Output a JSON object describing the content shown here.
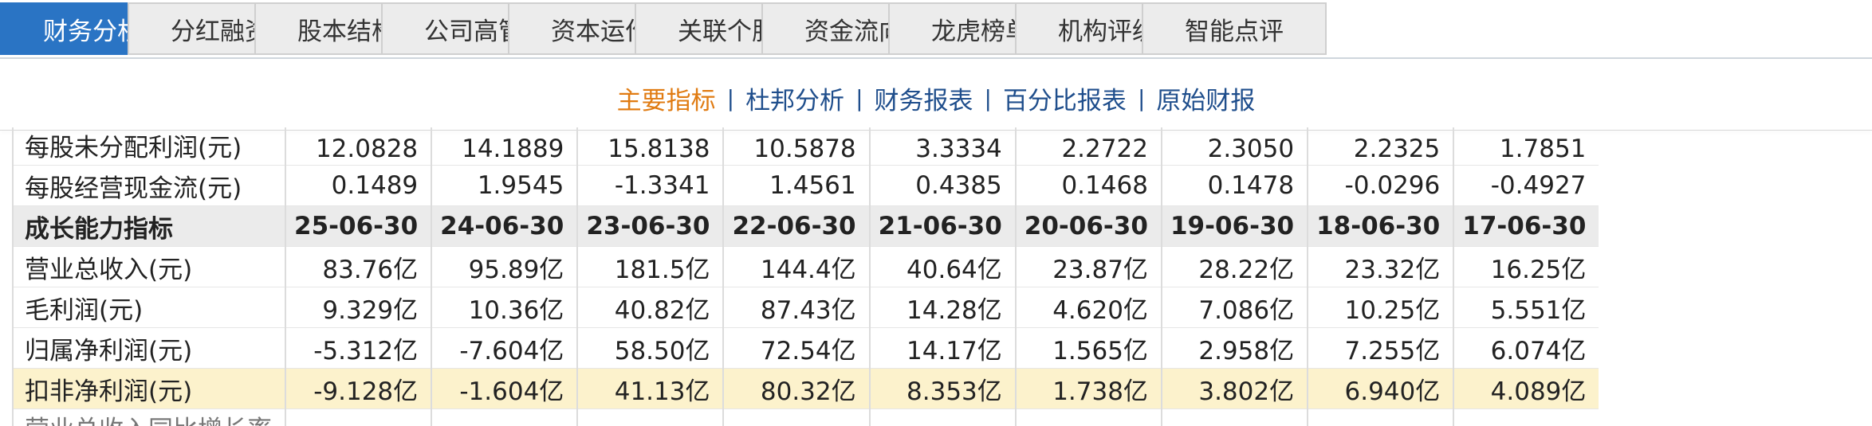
{
  "tabs": [
    "财务分析",
    "分红融资",
    "股本结构",
    "公司高管",
    "资本运作",
    "关联个股",
    "资金流向",
    "龙虎榜单",
    "机构评级",
    "智能点评"
  ],
  "active_tab": 0,
  "subnav": {
    "items": [
      "主要指标",
      "杜邦分析",
      "财务报表",
      "百分比报表",
      "原始财报"
    ],
    "active": 0,
    "separator": "|"
  },
  "table": {
    "rows": [
      {
        "label": "每股未分配利润(元)",
        "values": [
          "12.0828",
          "14.1889",
          "15.8138",
          "10.5878",
          "3.3334",
          "2.2722",
          "2.3050",
          "2.2325",
          "1.7851"
        ]
      },
      {
        "label": "每股经营现金流(元)",
        "values": [
          "0.1489",
          "1.9545",
          "-1.3341",
          "1.4561",
          "0.4385",
          "0.1468",
          "0.1478",
          "-0.0296",
          "-0.4927"
        ]
      },
      {
        "label": "成长能力指标",
        "values": [
          "25-06-30",
          "24-06-30",
          "23-06-30",
          "22-06-30",
          "21-06-30",
          "20-06-30",
          "19-06-30",
          "18-06-30",
          "17-06-30"
        ],
        "type": "header"
      },
      {
        "label": "营业总收入(元)",
        "values": [
          "83.76亿",
          "95.89亿",
          "181.5亿",
          "144.4亿",
          "40.64亿",
          "23.87亿",
          "28.22亿",
          "23.32亿",
          "16.25亿"
        ]
      },
      {
        "label": "毛利润(元)",
        "values": [
          "9.329亿",
          "10.36亿",
          "40.82亿",
          "87.43亿",
          "14.28亿",
          "4.620亿",
          "7.086亿",
          "10.25亿",
          "5.551亿"
        ]
      },
      {
        "label": "归属净利润(元)",
        "values": [
          "-5.312亿",
          "-7.604亿",
          "58.50亿",
          "72.54亿",
          "14.17亿",
          "1.565亿",
          "2.958亿",
          "7.255亿",
          "6.074亿"
        ]
      },
      {
        "label": "扣非净利润(元)",
        "values": [
          "-9.128亿",
          "-1.604亿",
          "41.13亿",
          "80.32亿",
          "8.353亿",
          "1.738亿",
          "3.802亿",
          "6.940亿",
          "4.089亿"
        ],
        "type": "highlight"
      },
      {
        "label": "营业总收入同比增长率",
        "values": [
          "",
          "",
          "",
          "",
          "",
          "",
          "",
          "",
          ""
        ],
        "type": "cut"
      }
    ]
  }
}
